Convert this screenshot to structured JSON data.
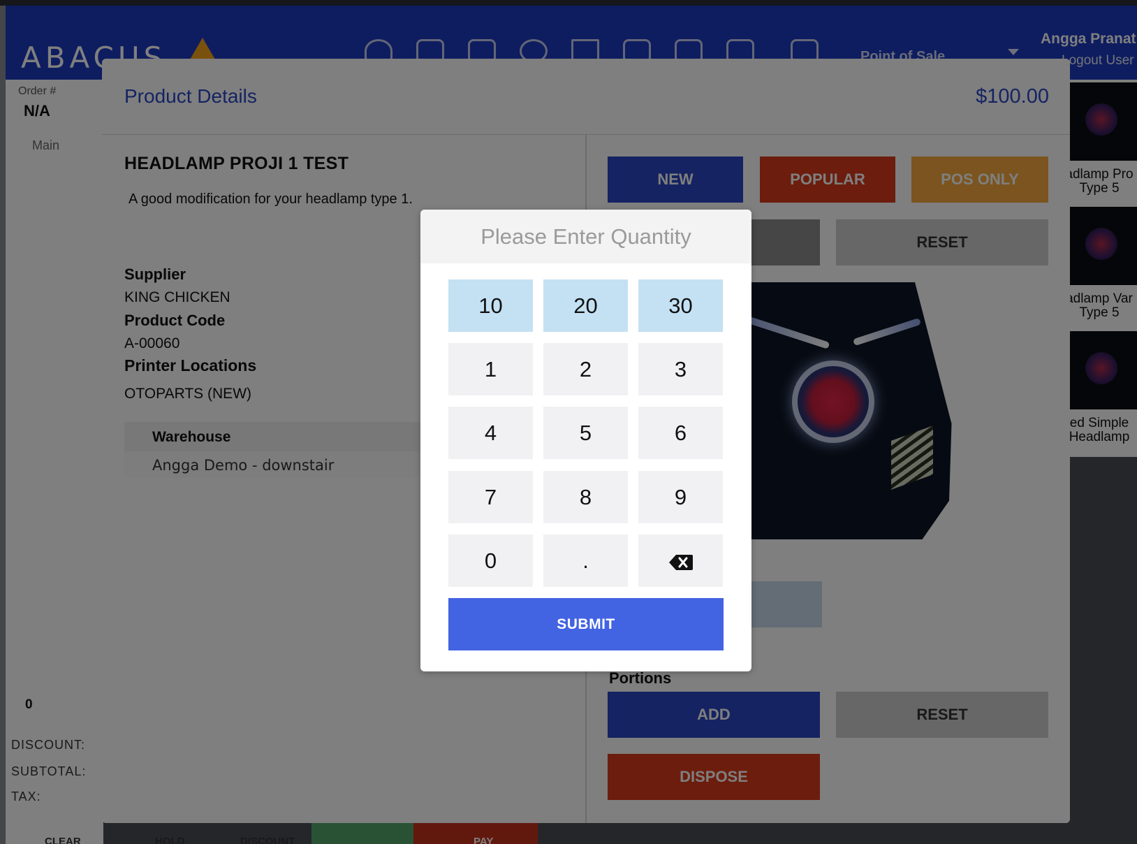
{
  "app": {
    "logo": "ABACUS",
    "pos_label": "Point of Sale",
    "user_name": "Angga Pranat",
    "logout": "Logout User"
  },
  "order": {
    "label": "Order #",
    "value": "N/A",
    "tab_main": "Main",
    "customer_count": "0",
    "discount_label": "DISCOUNT:",
    "subtotal_label": "SUBTOTAL:",
    "tax_label": "TAX:"
  },
  "footer": {
    "clear": "CLEAR",
    "hold": "HOLD",
    "discount": "DISCOUNT",
    "pay": "PAY"
  },
  "product_list": [
    {
      "name_line1": "adlamp Pro",
      "name_line2": "Type 5"
    },
    {
      "name_line1": "adlamp Var",
      "name_line2": "Type 5"
    },
    {
      "name_line1": "ed Simple",
      "name_line2": "Headlamp"
    }
  ],
  "modal": {
    "title": "Product Details",
    "price": "$100.00",
    "product_name": "HEADLAMP PROJI 1 TEST",
    "description": "A good modification for your headlamp type 1.",
    "supplier_label": "Supplier",
    "supplier": "KING CHICKEN",
    "code_label": "Product Code",
    "code": "A-00060",
    "printer_label": "Printer Locations",
    "printer": "OTOPARTS (NEW)",
    "warehouse_header": "Warehouse",
    "warehouse_row": "Angga Demo - downstair",
    "tags": {
      "new": "NEW",
      "popular": "POPULAR",
      "pos_only": "POS ONLY"
    },
    "modifier_reset": "RESET",
    "portions_label": "Portions",
    "portions_add": "ADD",
    "portions_reset": "RESET",
    "dispose": "DISPOSE"
  },
  "qty_dialog": {
    "title": "Please Enter Quantity",
    "quick": [
      "10",
      "20",
      "30"
    ],
    "keys": [
      "1",
      "2",
      "3",
      "4",
      "5",
      "6",
      "7",
      "8",
      "9",
      "0",
      "."
    ],
    "submit": "SUBMIT"
  },
  "colors": {
    "header_blue": "#1d3ac0",
    "title_blue": "#2b47c4",
    "btn_new": "#2b47c4",
    "btn_popular": "#d93b1a",
    "btn_pos_only": "#f6a83e",
    "btn_reset": "#cfcfcf",
    "btn_dispose": "#d93b1a",
    "quick_key": "#c4e1f3",
    "submit": "#4263e2"
  }
}
